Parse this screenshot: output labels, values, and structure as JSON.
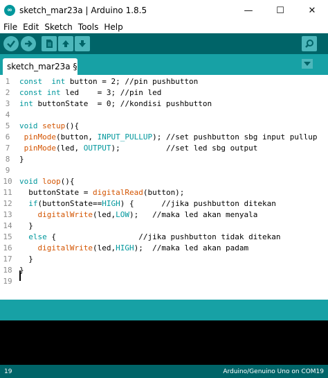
{
  "window": {
    "title": "sketch_mar23a | Arduino 1.8.5",
    "minimize": "—",
    "maximize": "☐",
    "close": "✕"
  },
  "menu": [
    "File",
    "Edit",
    "Sketch",
    "Tools",
    "Help"
  ],
  "toolbar": {
    "icons": [
      "verify-icon",
      "upload-icon",
      "new-icon",
      "open-icon",
      "save-icon",
      "serial-monitor-icon"
    ]
  },
  "tabs": {
    "active": "sketch_mar23a §"
  },
  "editor": {
    "lines": [
      {
        "n": "1",
        "segs": [
          [
            "kw",
            "const"
          ],
          [
            "",
            "  "
          ],
          [
            "kw",
            "int"
          ],
          [
            "",
            " button = 2; //pin pushbutton"
          ]
        ]
      },
      {
        "n": "2",
        "segs": [
          [
            "kw",
            "const"
          ],
          [
            "",
            " "
          ],
          [
            "kw",
            "int"
          ],
          [
            "",
            " led    = 3; //pin led"
          ]
        ]
      },
      {
        "n": "3",
        "segs": [
          [
            "kw",
            "int"
          ],
          [
            "",
            " buttonState  = 0; //kondisi pushbutton"
          ]
        ]
      },
      {
        "n": "4",
        "segs": []
      },
      {
        "n": "5",
        "segs": [
          [
            "kw",
            "void"
          ],
          [
            "",
            " "
          ],
          [
            "fn",
            "setup"
          ],
          [
            "",
            "(){"
          ]
        ]
      },
      {
        "n": "6",
        "segs": [
          [
            "",
            " "
          ],
          [
            "fn",
            "pinMode"
          ],
          [
            "",
            "(button, "
          ],
          [
            "const",
            "INPUT_PULLUP"
          ],
          [
            "",
            "); //set pushbutton sbg input pullup"
          ]
        ]
      },
      {
        "n": "7",
        "segs": [
          [
            "",
            " "
          ],
          [
            "fn",
            "pinMode"
          ],
          [
            "",
            "(led, "
          ],
          [
            "const",
            "OUTPUT"
          ],
          [
            "",
            ");          //set led sbg output"
          ]
        ]
      },
      {
        "n": "8",
        "segs": [
          [
            "",
            "}"
          ]
        ]
      },
      {
        "n": "9",
        "segs": []
      },
      {
        "n": "10",
        "segs": [
          [
            "kw",
            "void"
          ],
          [
            "",
            " "
          ],
          [
            "fn",
            "loop"
          ],
          [
            "",
            "(){"
          ]
        ]
      },
      {
        "n": "11",
        "segs": [
          [
            "",
            "  buttonState = "
          ],
          [
            "fn",
            "digitalRead"
          ],
          [
            "",
            "(button);"
          ]
        ]
      },
      {
        "n": "12",
        "segs": [
          [
            "",
            "  "
          ],
          [
            "kw",
            "if"
          ],
          [
            "",
            "(buttonState=="
          ],
          [
            "const",
            "HIGH"
          ],
          [
            "",
            ") {      //jika pushbutton ditekan"
          ]
        ]
      },
      {
        "n": "13",
        "segs": [
          [
            "",
            "    "
          ],
          [
            "fn",
            "digitalWrite"
          ],
          [
            "",
            "(led,"
          ],
          [
            "const",
            "LOW"
          ],
          [
            "",
            ");   //maka led akan menyala"
          ]
        ]
      },
      {
        "n": "14",
        "segs": [
          [
            "",
            "  }"
          ]
        ]
      },
      {
        "n": "15",
        "segs": [
          [
            "",
            "  "
          ],
          [
            "kw",
            "else"
          ],
          [
            "",
            " {                  //jika pushbutton tidak ditekan"
          ]
        ]
      },
      {
        "n": "16",
        "segs": [
          [
            "",
            "    "
          ],
          [
            "fn",
            "digitalWrite"
          ],
          [
            "",
            "(led,"
          ],
          [
            "const",
            "HIGH"
          ],
          [
            "",
            ");  //maka led akan padam"
          ]
        ]
      },
      {
        "n": "17",
        "segs": [
          [
            "",
            "  }"
          ]
        ]
      },
      {
        "n": "18",
        "segs": [
          [
            "",
            "}"
          ]
        ]
      },
      {
        "n": "19",
        "segs": []
      }
    ]
  },
  "status": {
    "line": "19",
    "board": "Arduino/Genuino Uno on COM19"
  },
  "colors": {
    "toolbar": "#006468",
    "tabstrip": "#17a1a5",
    "keyword": "#00979c",
    "function": "#d35400"
  }
}
